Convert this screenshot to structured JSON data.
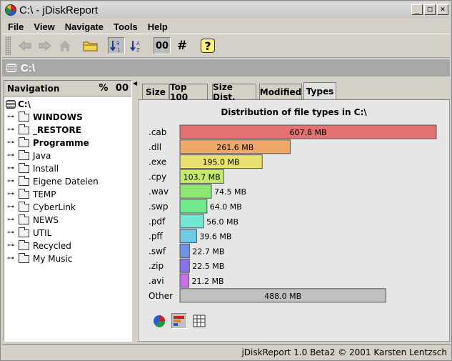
{
  "window": {
    "title": "C:\\ - jDiskReport",
    "min": "_",
    "max": "□",
    "close": "×"
  },
  "menu": [
    "File",
    "View",
    "Navigate",
    "Tools",
    "Help"
  ],
  "toolbar": {
    "sort_label": "00",
    "hash_label": "#",
    "help_label": "?"
  },
  "path": "C:\\",
  "nav": {
    "title": "Navigation",
    "pct_label": "%",
    "num_label": "00",
    "root": "C:\\",
    "items": [
      {
        "label": "WINDOWS",
        "bold": true
      },
      {
        "label": "_RESTORE",
        "bold": true
      },
      {
        "label": "Programme",
        "bold": true
      },
      {
        "label": "Java",
        "bold": false
      },
      {
        "label": "Install",
        "bold": false
      },
      {
        "label": "Eigene Dateien",
        "bold": false
      },
      {
        "label": "TEMP",
        "bold": false
      },
      {
        "label": "CyberLink",
        "bold": false
      },
      {
        "label": "NEWS",
        "bold": false
      },
      {
        "label": "UTIL",
        "bold": false
      },
      {
        "label": "Recycled",
        "bold": false
      },
      {
        "label": "My Music",
        "bold": false
      }
    ]
  },
  "tabs": [
    "Size",
    "Top 100",
    "Size Dist.",
    "Modified",
    "Types"
  ],
  "active_tab": "Types",
  "chart_data": {
    "type": "bar",
    "title": "Distribution of file types in C:\\",
    "categories": [
      ".cab",
      ".dll",
      ".exe",
      ".cpy",
      ".wav",
      ".swp",
      ".pdf",
      ".pff",
      ".swf",
      ".zip",
      ".avi",
      "Other"
    ],
    "values": [
      607.8,
      261.6,
      195.0,
      103.7,
      74.5,
      64.0,
      56.0,
      39.6,
      22.7,
      22.5,
      21.2,
      488.0
    ],
    "labels": [
      "607.8 MB",
      "261.6 MB",
      "195.0 MB",
      "103.7 MB",
      "74.5 MB",
      "64.0 MB",
      "56.0 MB",
      "39.6 MB",
      "22.7 MB",
      "22.5 MB",
      "21.2 MB",
      "488.0 MB"
    ],
    "colors": [
      "#e37272",
      "#eda86a",
      "#e8e070",
      "#c4ea70",
      "#8ae872",
      "#72e88c",
      "#72e8d4",
      "#72c8e8",
      "#7294e8",
      "#8a72e8",
      "#c472e8",
      "#c0c0c0"
    ],
    "unit": "MB"
  },
  "status": "jDiskReport 1.0 Beta2 © 2001 Karsten Lentzsch"
}
